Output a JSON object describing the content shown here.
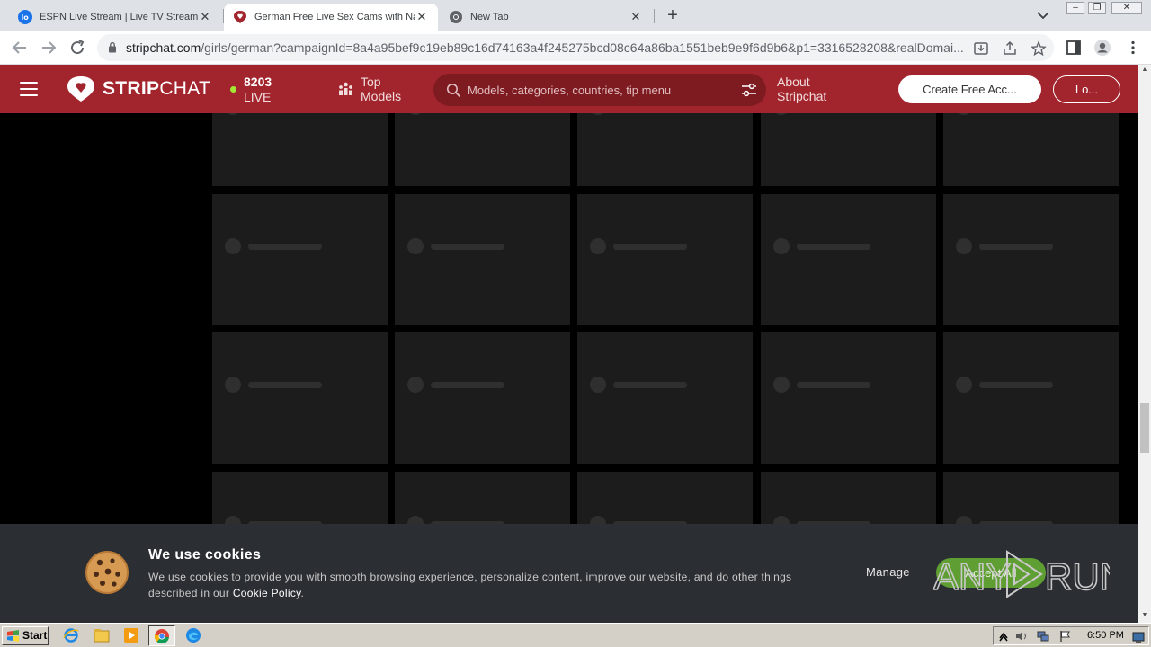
{
  "browser": {
    "tabs": [
      {
        "title": "ESPN Live Stream | Live TV Streams",
        "favicon": "espn-livetv-icon",
        "active": false
      },
      {
        "title": "German Free Live Sex Cams with Na",
        "favicon": "stripchat-icon",
        "active": true
      },
      {
        "title": "New Tab",
        "favicon": "chrome-icon",
        "active": false
      }
    ],
    "new_tab_label": "+",
    "url_host": "stripchat.com",
    "url_path": "/girls/german?campaignId=8a4a95bef9c19eb89c16d74163a4f245275bcd08c64a86ba1551beb9e9f6d9b6&p1=3316528208&realDomai..."
  },
  "header": {
    "brand_bold": "STRIP",
    "brand_light": "CHAT",
    "live_count": "8203",
    "live_label": "LIVE",
    "top_models_line1": "Top",
    "top_models_line2": "Models",
    "search_placeholder": "Models, categories, countries, tip menu",
    "about_line1": "About",
    "about_line2": "Stripchat",
    "create_account_label": "Create Free Acc...",
    "login_label": "Lo..."
  },
  "grid": {
    "columns": 5,
    "rows": 4,
    "state": "loading-placeholders"
  },
  "cookie_banner": {
    "title": "We use cookies",
    "text": "We use cookies to provide you with smooth browsing experience, personalize content, improve our website, and do other things described in our",
    "link": "Cookie Policy",
    "text_end": ".",
    "manage_label": "Manage",
    "accept_label": "Accept All"
  },
  "watermark": {
    "text_left": "ANY",
    "text_right": "RUN"
  },
  "taskbar": {
    "start_label": "Start",
    "clock": "6:50 PM"
  },
  "colors": {
    "header_bg": "#a2252d",
    "search_bg": "#7d1b21",
    "live_dot": "#a3e635",
    "card_bg": "#1c1c1c",
    "cookie_bg": "#2b2f33",
    "accept_bg": "#5f9e33"
  }
}
